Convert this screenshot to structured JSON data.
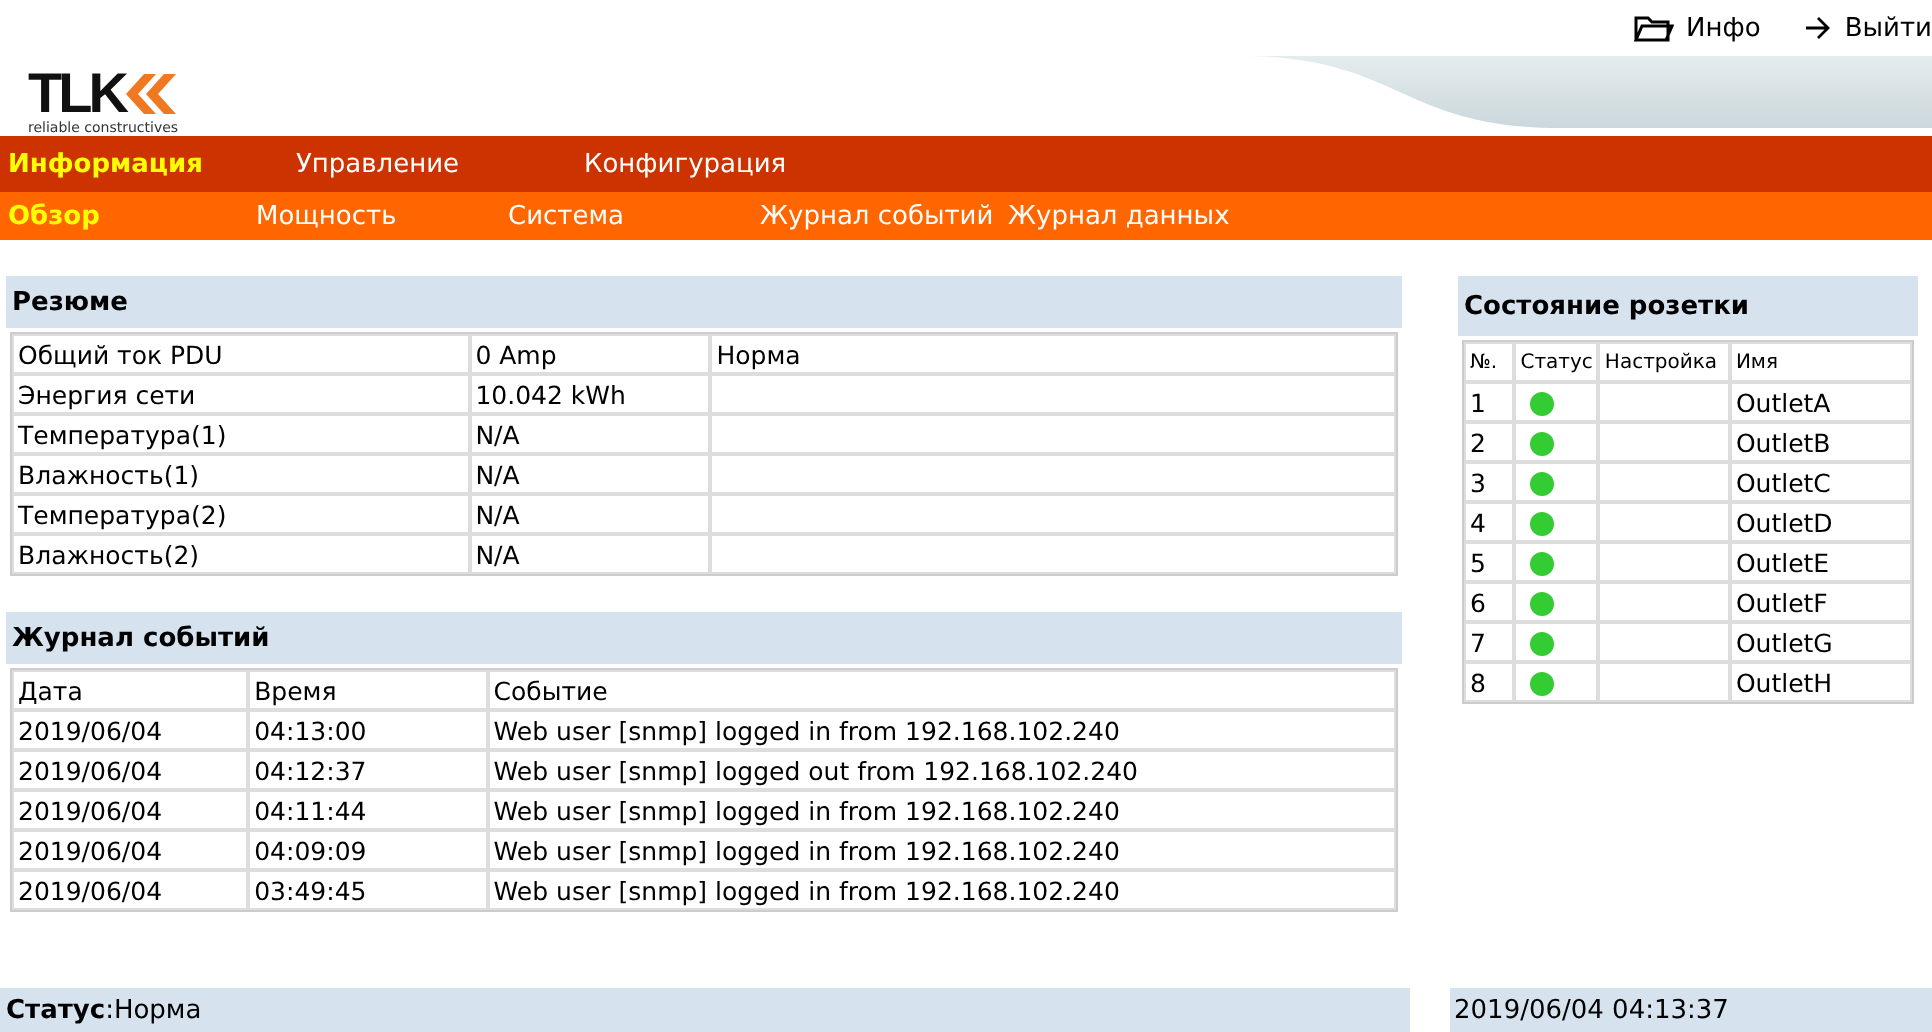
{
  "top_links": [
    {
      "kind": "folder",
      "label": "Инфо"
    },
    {
      "kind": "arrow",
      "label": "Выйти"
    }
  ],
  "logo": {
    "text": "TLK",
    "tagline": "reliable constructives"
  },
  "main_nav": [
    {
      "label": "Информация",
      "selected": true
    },
    {
      "label": "Управление",
      "selected": false
    },
    {
      "label": "Конфигурация",
      "selected": false
    }
  ],
  "sub_nav": [
    {
      "label": "Обзор",
      "selected": true
    },
    {
      "label": "Мощность",
      "selected": false
    },
    {
      "label": "Система",
      "selected": false
    },
    {
      "label": "Журнал событий",
      "selected": false
    },
    {
      "label": "Журнал данных",
      "selected": false
    }
  ],
  "summary": {
    "title": "Резюме",
    "rows": [
      [
        "Общий ток PDU",
        "0 Amp",
        "Норма"
      ],
      [
        "Энергия сети",
        "10.042 kWh",
        ""
      ],
      [
        "Температура(1)",
        "N/A",
        ""
      ],
      [
        "Влажность(1)",
        "N/A",
        ""
      ],
      [
        "Температура(2)",
        "N/A",
        ""
      ],
      [
        "Влажность(2)",
        "N/A",
        ""
      ]
    ]
  },
  "event_log": {
    "title": "Журнал событий",
    "columns": [
      "Дата",
      "Время",
      "Событие"
    ],
    "rows": [
      [
        "2019/06/04",
        "04:13:00",
        "Web user [snmp] logged in from 192.168.102.240"
      ],
      [
        "2019/06/04",
        "04:12:37",
        "Web user [snmp] logged out from 192.168.102.240"
      ],
      [
        "2019/06/04",
        "04:11:44",
        "Web user [snmp] logged in from 192.168.102.240"
      ],
      [
        "2019/06/04",
        "04:09:09",
        "Web user [snmp] logged in from 192.168.102.240"
      ],
      [
        "2019/06/04",
        "03:49:45",
        "Web user [snmp] logged in from 192.168.102.240"
      ]
    ]
  },
  "outlets": {
    "title": "Состояние розетки",
    "columns": [
      "№.",
      "Статус",
      "Настройка",
      "Имя"
    ],
    "rows": [
      {
        "number": "1",
        "on": true,
        "name": "OutletA"
      },
      {
        "number": "2",
        "on": true,
        "name": "OutletB"
      },
      {
        "number": "3",
        "on": true,
        "name": "OutletC"
      },
      {
        "number": "4",
        "on": true,
        "name": "OutletD"
      },
      {
        "number": "5",
        "on": true,
        "name": "OutletE"
      },
      {
        "number": "6",
        "on": true,
        "name": "OutletF"
      },
      {
        "number": "7",
        "on": true,
        "name": "OutletG"
      },
      {
        "number": "8",
        "on": true,
        "name": "OutletH"
      }
    ]
  },
  "status_bar": {
    "status": "**Статус**:Норма",
    "datetime": "2019/06/04 04:13:37"
  }
}
